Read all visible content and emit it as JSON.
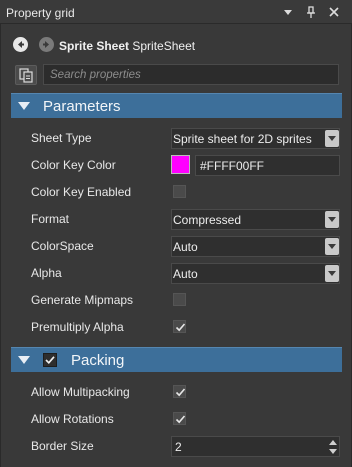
{
  "window": {
    "title": "Property grid"
  },
  "header": {
    "object_name": "Sprite Sheet",
    "object_type": "SpriteSheet"
  },
  "search": {
    "placeholder": "Search properties"
  },
  "sections": {
    "parameters": {
      "label": "Parameters"
    },
    "packing": {
      "label": "Packing",
      "enabled": true
    }
  },
  "properties": {
    "sheet_type": {
      "label": "Sheet Type",
      "value": "Sprite sheet for 2D sprites"
    },
    "color_key_color": {
      "label": "Color Key Color",
      "value": "#FFFF00FF",
      "swatch": "#ff00ff"
    },
    "color_key_enabled": {
      "label": "Color Key Enabled",
      "checked": false
    },
    "format": {
      "label": "Format",
      "value": "Compressed"
    },
    "color_space": {
      "label": "ColorSpace",
      "value": "Auto"
    },
    "alpha": {
      "label": "Alpha",
      "value": "Auto"
    },
    "generate_mipmaps": {
      "label": "Generate Mipmaps",
      "checked": false
    },
    "premultiply_alpha": {
      "label": "Premultiply Alpha",
      "checked": true
    },
    "allow_multipacking": {
      "label": "Allow Multipacking",
      "checked": true
    },
    "allow_rotations": {
      "label": "Allow Rotations",
      "checked": true
    },
    "border_size": {
      "label": "Border Size",
      "value": "2"
    }
  },
  "colors": {
    "section_header": "#3d6f9a",
    "panel_bg": "#393939",
    "field_bg": "#2f2f2f"
  }
}
